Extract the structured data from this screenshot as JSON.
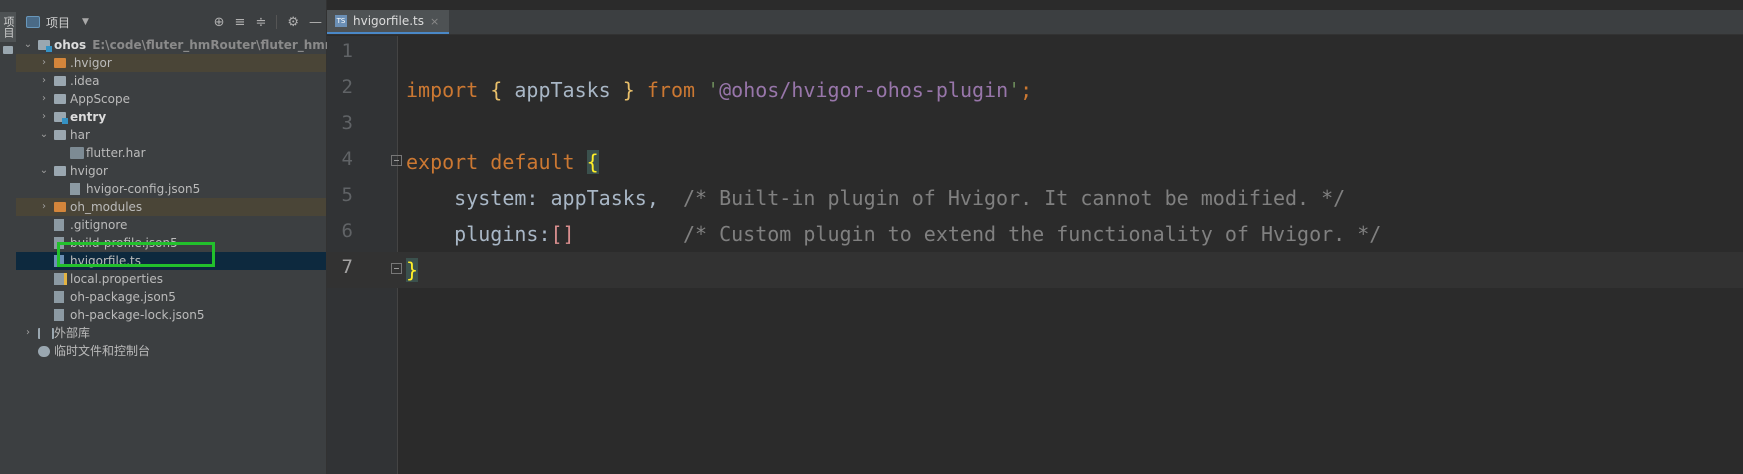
{
  "toolstrip": {
    "vertical_tab_label": "项目"
  },
  "project": {
    "title": "项目",
    "tools": {
      "locate": "⊕",
      "expand": "≡",
      "collapse": "≑",
      "settings": "⚙",
      "hide": "—"
    },
    "tree": [
      {
        "label": "ohos",
        "path": "E:\\code\\fluter_hmRouter\\fluter_hmrouter\\ohos",
        "chev": "⌄",
        "icon": "module",
        "depth": 0,
        "bold": true
      },
      {
        "label": ".hvigor",
        "chev": "›",
        "icon": "folder-orange",
        "depth": 1,
        "hl": "orange"
      },
      {
        "label": ".idea",
        "chev": "›",
        "icon": "folder",
        "depth": 1
      },
      {
        "label": "AppScope",
        "chev": "›",
        "icon": "folder",
        "depth": 1
      },
      {
        "label": "entry",
        "chev": "›",
        "icon": "module",
        "depth": 1,
        "bold": true
      },
      {
        "label": "har",
        "chev": "⌄",
        "icon": "folder",
        "depth": 1
      },
      {
        "label": "flutter.har",
        "icon": "har",
        "depth": 2
      },
      {
        "label": "hvigor",
        "chev": "⌄",
        "icon": "folder",
        "depth": 1
      },
      {
        "label": "hvigor-config.json5",
        "icon": "file",
        "depth": 2
      },
      {
        "label": "oh_modules",
        "chev": "›",
        "icon": "folder-orange",
        "depth": 1,
        "hl": "orange"
      },
      {
        "label": ".gitignore",
        "icon": "file",
        "depth": 1
      },
      {
        "label": "build-profile.json5",
        "icon": "file",
        "depth": 1
      },
      {
        "label": "hvigorfile.ts",
        "icon": "file-ts",
        "depth": 1,
        "selected": true
      },
      {
        "label": "local.properties",
        "icon": "file-props",
        "depth": 1
      },
      {
        "label": "oh-package.json5",
        "icon": "file",
        "depth": 1
      },
      {
        "label": "oh-package-lock.json5",
        "icon": "file",
        "depth": 1
      },
      {
        "label": "外部库",
        "chev": "›",
        "icon": "lib",
        "depth": 0
      },
      {
        "label": "临时文件和控制台",
        "icon": "scratch",
        "depth": 0
      }
    ]
  },
  "editor": {
    "tab": {
      "label": "hvigorfile.ts",
      "close": "×",
      "icon_text": "TS"
    },
    "line_numbers": [
      "1",
      "2",
      "3",
      "4",
      "5",
      "6",
      "7"
    ],
    "current_line": 7,
    "code": {
      "l2": {
        "kw_import": "import",
        "brace_open": "{",
        "name": " appTasks ",
        "brace_close": "}",
        "kw_from": "from",
        "str_q1": "'",
        "str_body": "@ohos/hvigor-ohos-plugin",
        "str_q2": "'",
        "semi": ";"
      },
      "l4": {
        "kw_export": "export",
        "kw_default": "default",
        "brace": "{"
      },
      "l5": {
        "prop": "system: appTasks,",
        "comment": "/* Built-in plugin of Hvigor. It cannot be modified. */"
      },
      "l6": {
        "prop": "plugins:",
        "arr": "[]",
        "comment": "/* Custom plugin to extend the functionality of Hvigor. */"
      },
      "l7": {
        "brace": "}"
      }
    }
  }
}
